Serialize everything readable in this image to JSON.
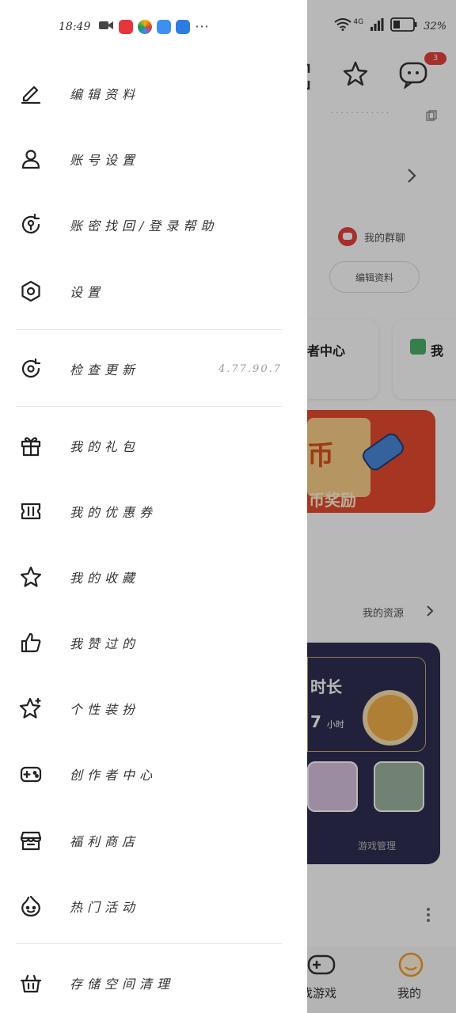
{
  "status_bar": {
    "time": "18:49",
    "battery": "32%",
    "network": "4G",
    "more": "···"
  },
  "drawer": {
    "menu_items": [
      {
        "label": "编辑资料",
        "icon": "pencil-icon"
      },
      {
        "label": "账号设置",
        "icon": "user-icon"
      },
      {
        "label": "账密找回/登录帮助",
        "icon": "account-recovery-icon"
      },
      {
        "label": "设置",
        "icon": "hexagon-gear-icon"
      },
      {
        "label": "检查更新",
        "icon": "refresh-icon",
        "value": "4.77.90.7"
      },
      {
        "label": "我的礼包",
        "icon": "gift-icon"
      },
      {
        "label": "我的优惠券",
        "icon": "coupon-icon"
      },
      {
        "label": "我的收藏",
        "icon": "star-icon"
      },
      {
        "label": "我赞过的",
        "icon": "thumbs-up-icon"
      },
      {
        "label": "个性装扮",
        "icon": "sparkle-star-icon"
      },
      {
        "label": "创作者中心",
        "icon": "gamepad-icon"
      },
      {
        "label": "福利商店",
        "icon": "store-icon"
      },
      {
        "label": "热门活动",
        "icon": "smiley-flame-icon"
      },
      {
        "label": "存储空间清理",
        "icon": "basket-icon"
      }
    ]
  },
  "background": {
    "badge_count": "3",
    "mine_chip": "我的群聊",
    "edit_profile_button": "编辑资料",
    "creator_center": "者中心",
    "welfare": "我",
    "coin_reward": "币奖励",
    "my_assets": "我的资源",
    "duration_title": "时长",
    "duration_value": "7",
    "duration_unit": "小时",
    "manage_label": "游戏管理",
    "nav_games": "找游戏",
    "nav_mine": "我的"
  },
  "colors": {
    "accent": "#e5423b",
    "nav_active": "#f0a030",
    "drawer_bg": "#ffffff"
  }
}
